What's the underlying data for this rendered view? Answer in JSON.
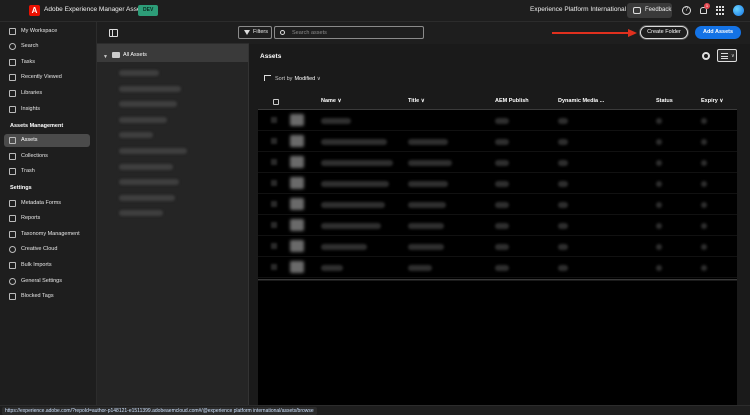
{
  "app": {
    "title": "Adobe Experience Manager Assets",
    "logo_letter": "A",
    "environment_badge": "DEV",
    "org_name": "Experience Platform International",
    "feedback_label": "Feedback",
    "help_glyph": "?",
    "notification_count": "1"
  },
  "sidebar": {
    "items": [
      {
        "label": "My Workspace",
        "icon": "home-icon"
      },
      {
        "label": "Search",
        "icon": "search-icon"
      },
      {
        "label": "Tasks",
        "icon": "tasks-icon"
      },
      {
        "label": "Recently Viewed",
        "icon": "recent-icon"
      },
      {
        "label": "Libraries",
        "icon": "libraries-icon"
      },
      {
        "label": "Insights",
        "icon": "insights-icon"
      }
    ],
    "section_assets": "Assets Management",
    "assets_items": [
      {
        "label": "Assets",
        "icon": "assets-icon",
        "active": true
      },
      {
        "label": "Collections",
        "icon": "collections-icon"
      },
      {
        "label": "Trash",
        "icon": "trash-icon"
      }
    ],
    "section_settings": "Settings",
    "settings_items": [
      {
        "label": "Metadata Forms",
        "icon": "forms-icon"
      },
      {
        "label": "Reports",
        "icon": "reports-icon"
      },
      {
        "label": "Taxonomy Management",
        "icon": "taxonomy-icon"
      },
      {
        "label": "Creative Cloud",
        "icon": "creative-cloud-icon"
      },
      {
        "label": "Bulk Imports",
        "icon": "import-icon"
      },
      {
        "label": "General Settings",
        "icon": "settings-icon"
      },
      {
        "label": "Blocked Tags",
        "icon": "blocked-tags-icon"
      }
    ]
  },
  "tree": {
    "root_label": "All Assets"
  },
  "toolbar": {
    "filters_label": "Filters",
    "search_placeholder": "Search assets",
    "create_folder_label": "Create Folder",
    "add_assets_label": "Add Assets"
  },
  "main": {
    "title": "Assets",
    "sort_label": "Sort by",
    "sort_value": "Modified"
  },
  "table": {
    "columns": [
      "Name",
      "Title",
      "AEM Publish",
      "Dynamic Media ...",
      "Status",
      "Expiry"
    ]
  },
  "status_url": "https://experience.adobe.com/?repoId=author-p148121-e1511399.adobeaemcloud.com#/@experience platform international/assets/browse",
  "colors": {
    "accent": "#1473e6",
    "annotation_arrow": "#e0301e",
    "badge": "#2d9d78"
  }
}
